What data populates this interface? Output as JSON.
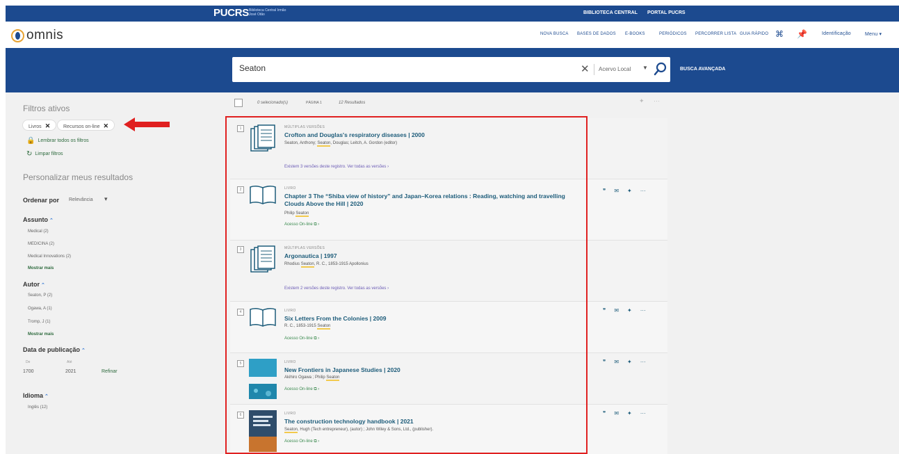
{
  "topbar": {
    "logo": "PUCRS",
    "sub": "Biblioteca Central Irmão José Otão",
    "links": [
      "BIBLIOTECA CENTRAL",
      "PORTAL PUCRS"
    ]
  },
  "header": {
    "logo": "omnis",
    "nav": [
      "NOVA BUSCA",
      "BASES DE DADOS",
      "E-BOOKS",
      "PERIÓDICOS",
      "PERCORRER LISTA",
      "GUIA RÁPIDO"
    ],
    "icons": [
      "bookmarks-icon",
      "pin-icon"
    ],
    "login": "Identificação",
    "menu": "Menu"
  },
  "search": {
    "value": "Seaton",
    "scope": "Acervo Local",
    "advanced": "BUSCA AVANÇADA"
  },
  "sidebar": {
    "active_filters_title": "Filtros ativos",
    "chips": [
      "Livros",
      "Recursos on-line"
    ],
    "remember": "Lembrar todos os filtros",
    "clear": "Limpar filtros",
    "personalize": "Personalizar meus resultados",
    "sort_label": "Ordenar por",
    "sort_value": "Relevância",
    "facets": {
      "subject": {
        "title": "Assunto",
        "items": [
          "Medical (2)",
          "MEDICINA (2)",
          "Medical Innovations (2)"
        ],
        "more": "Mostrar mais"
      },
      "author": {
        "title": "Autor",
        "items": [
          "Seaton, P (2)",
          "Ogawa, A (1)",
          "Tromp, J (1)"
        ],
        "more": "Mostrar mais"
      },
      "date": {
        "title": "Data de publicação",
        "from_label": "De",
        "to_label": "Até",
        "from": "1700",
        "to": "2021",
        "refine": "Refinar"
      },
      "language": {
        "title": "Idioma",
        "items": [
          "Inglês (12)"
        ]
      }
    }
  },
  "results_bar": {
    "selected": "0 selecionado(s)",
    "page": "PÁGINA 1",
    "count": "12 Resultados"
  },
  "records": [
    {
      "num": "1",
      "type": "MÚLTIPLAS VERSÕES",
      "title": "Crofton and Douglas's respiratory diseases | 2000",
      "author_pre": "Seaton, Anthony; ",
      "author_hl": "Seaton",
      "author_post": ", Douglas; Leitch, A. Gordon (editor)",
      "link": "Existem 3 versões deste registro. Ver todas as versões  ›"
    },
    {
      "num": "2",
      "type": "LIVRO",
      "title": "Chapter 3 The “Shiba view of history” and Japan–Korea relations : Reading, watching and travelling Clouds Above the Hill | 2020",
      "author_pre": "Philip ",
      "author_hl": "Seaton",
      "author_post": "",
      "link": "Acesso On-line ⧉  ›"
    },
    {
      "num": "3",
      "type": "MÚLTIPLAS VERSÕES",
      "title": "Argonautica | 1997",
      "author_pre": "Rhodius ",
      "author_hl": "Seaton",
      "author_post": ", R. C., 1853-1915 Apollonius",
      "link": "Existem 2 versões deste registro. Ver todas as versões  ›"
    },
    {
      "num": "4",
      "type": "LIVRO",
      "title": "Six Letters From the Colonies | 2009",
      "author_pre": "R. C., 1853-1915 ",
      "author_hl": "Seaton",
      "author_post": "",
      "link": "Acesso On-line ⧉  ›"
    },
    {
      "num": "5",
      "type": "LIVRO",
      "title": "New Frontiers in Japanese Studies | 2020",
      "author_pre": "Akihiro Ogawa ; Philip ",
      "author_hl": "Seaton",
      "author_post": "",
      "link": "Acesso On-line ⧉  ›"
    },
    {
      "num": "6",
      "type": "LIVRO",
      "title": "The construction technology handbook | 2021",
      "author_pre": "",
      "author_hl": "Seaton",
      "author_post": ", Hugh (Tech entrepreneur), (autor) ; John Wiley & Sons, Ltd., (publisher).",
      "link": "Acesso On-line ⧉  ›"
    }
  ],
  "colors": {
    "brand": "#1c4a8f",
    "accent": "#e8a332",
    "annotation": "#e02020",
    "link_green": "#3a8a4e"
  }
}
